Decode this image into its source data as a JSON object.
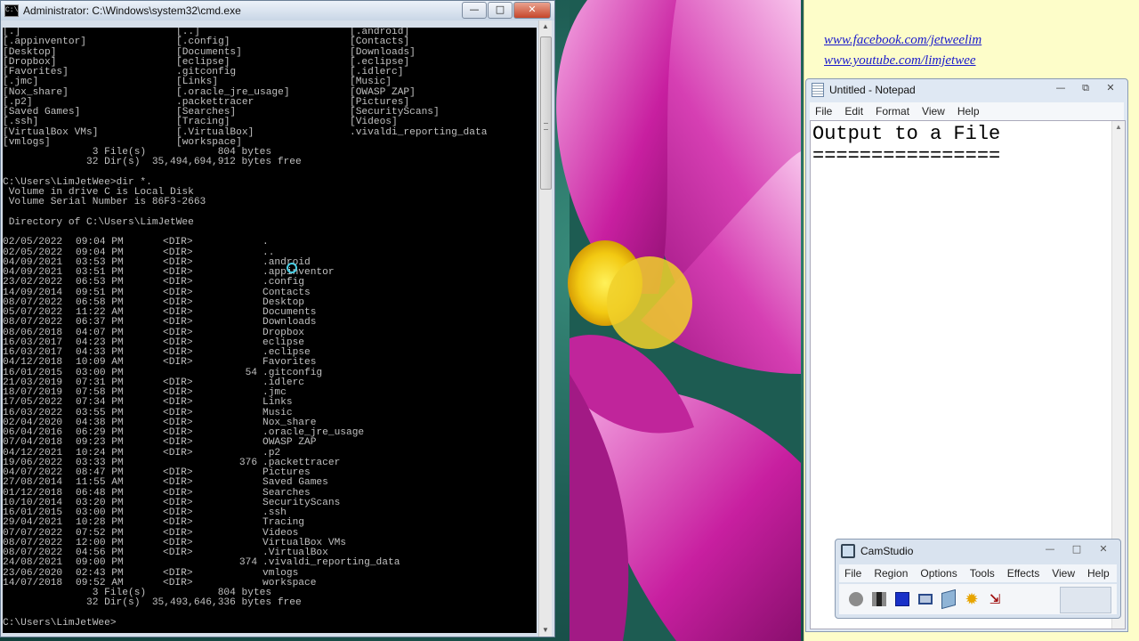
{
  "cmd": {
    "title": "Administrator: C:\\Windows\\system32\\cmd.exe",
    "icon": "cmd-icon",
    "buttons": {
      "minimize": "—",
      "maximize": "□",
      "close": "✕"
    },
    "wide_listing": [
      [
        "[.]",
        "[..]",
        "[.android]"
      ],
      [
        "[.appinventor]",
        "[.config]",
        "[Contacts]"
      ],
      [
        "[Desktop]",
        "[Documents]",
        "[Downloads]"
      ],
      [
        "[Dropbox]",
        "[eclipse]",
        "[.eclipse]"
      ],
      [
        "[Favorites]",
        ".gitconfig",
        "[.idlerc]"
      ],
      [
        "[.jmc]",
        "[Links]",
        "[Music]"
      ],
      [
        "[Nox_share]",
        "[.oracle_jre_usage]",
        "[OWASP ZAP]"
      ],
      [
        "[.p2]",
        ".packettracer",
        "[Pictures]"
      ],
      [
        "[Saved Games]",
        "[Searches]",
        "[SecurityScans]"
      ],
      [
        "[.ssh]",
        "[Tracing]",
        "[Videos]"
      ],
      [
        "[VirtualBox VMs]",
        "[.VirtualBox]",
        ".vivaldi_reporting_data"
      ],
      [
        "[vmlogs]",
        "[workspace]",
        ""
      ]
    ],
    "wide_summary": [
      "               3 File(s)            804 bytes",
      "              32 Dir(s)  35,494,694,912 bytes free"
    ],
    "command": "C:\\Users\\LimJetWee>dir *.",
    "volume_lines": [
      " Volume in drive C is Local Disk",
      " Volume Serial Number is 86F3-2663",
      "",
      " Directory of C:\\Users\\LimJetWee"
    ],
    "entries": [
      {
        "date": "02/05/2022",
        "time": "09:04 PM",
        "type": "<DIR>",
        "size": "",
        "name": "."
      },
      {
        "date": "02/05/2022",
        "time": "09:04 PM",
        "type": "<DIR>",
        "size": "",
        "name": ".."
      },
      {
        "date": "04/09/2021",
        "time": "03:53 PM",
        "type": "<DIR>",
        "size": "",
        "name": ".android"
      },
      {
        "date": "04/09/2021",
        "time": "03:51 PM",
        "type": "<DIR>",
        "size": "",
        "name": ".appinventor"
      },
      {
        "date": "23/02/2022",
        "time": "06:53 PM",
        "type": "<DIR>",
        "size": "",
        "name": ".config"
      },
      {
        "date": "14/09/2014",
        "time": "09:51 PM",
        "type": "<DIR>",
        "size": "",
        "name": "Contacts"
      },
      {
        "date": "08/07/2022",
        "time": "06:58 PM",
        "type": "<DIR>",
        "size": "",
        "name": "Desktop"
      },
      {
        "date": "05/07/2022",
        "time": "11:22 AM",
        "type": "<DIR>",
        "size": "",
        "name": "Documents"
      },
      {
        "date": "08/07/2022",
        "time": "06:37 PM",
        "type": "<DIR>",
        "size": "",
        "name": "Downloads"
      },
      {
        "date": "08/06/2018",
        "time": "04:07 PM",
        "type": "<DIR>",
        "size": "",
        "name": "Dropbox"
      },
      {
        "date": "16/03/2017",
        "time": "04:23 PM",
        "type": "<DIR>",
        "size": "",
        "name": "eclipse"
      },
      {
        "date": "16/03/2017",
        "time": "04:33 PM",
        "type": "<DIR>",
        "size": "",
        "name": ".eclipse"
      },
      {
        "date": "04/12/2018",
        "time": "10:09 AM",
        "type": "<DIR>",
        "size": "",
        "name": "Favorites"
      },
      {
        "date": "16/01/2015",
        "time": "03:00 PM",
        "type": "",
        "size": "54",
        "name": ".gitconfig"
      },
      {
        "date": "21/03/2019",
        "time": "07:31 PM",
        "type": "<DIR>",
        "size": "",
        "name": ".idlerc"
      },
      {
        "date": "18/07/2019",
        "time": "07:58 PM",
        "type": "<DIR>",
        "size": "",
        "name": ".jmc"
      },
      {
        "date": "17/05/2022",
        "time": "07:34 PM",
        "type": "<DIR>",
        "size": "",
        "name": "Links"
      },
      {
        "date": "16/03/2022",
        "time": "03:55 PM",
        "type": "<DIR>",
        "size": "",
        "name": "Music"
      },
      {
        "date": "02/04/2020",
        "time": "04:38 PM",
        "type": "<DIR>",
        "size": "",
        "name": "Nox_share"
      },
      {
        "date": "06/04/2016",
        "time": "06:29 PM",
        "type": "<DIR>",
        "size": "",
        "name": ".oracle_jre_usage"
      },
      {
        "date": "07/04/2018",
        "time": "09:23 PM",
        "type": "<DIR>",
        "size": "",
        "name": "OWASP ZAP"
      },
      {
        "date": "04/12/2021",
        "time": "10:24 PM",
        "type": "<DIR>",
        "size": "",
        "name": ".p2"
      },
      {
        "date": "19/06/2022",
        "time": "03:33 PM",
        "type": "",
        "size": "376",
        "name": ".packettracer"
      },
      {
        "date": "04/07/2022",
        "time": "08:47 PM",
        "type": "<DIR>",
        "size": "",
        "name": "Pictures"
      },
      {
        "date": "27/08/2014",
        "time": "11:55 AM",
        "type": "<DIR>",
        "size": "",
        "name": "Saved Games"
      },
      {
        "date": "01/12/2018",
        "time": "06:48 PM",
        "type": "<DIR>",
        "size": "",
        "name": "Searches"
      },
      {
        "date": "10/10/2014",
        "time": "03:20 PM",
        "type": "<DIR>",
        "size": "",
        "name": "SecurityScans"
      },
      {
        "date": "16/01/2015",
        "time": "03:00 PM",
        "type": "<DIR>",
        "size": "",
        "name": ".ssh"
      },
      {
        "date": "29/04/2021",
        "time": "10:28 PM",
        "type": "<DIR>",
        "size": "",
        "name": "Tracing"
      },
      {
        "date": "07/07/2022",
        "time": "07:52 PM",
        "type": "<DIR>",
        "size": "",
        "name": "Videos"
      },
      {
        "date": "08/07/2022",
        "time": "12:00 PM",
        "type": "<DIR>",
        "size": "",
        "name": "VirtualBox VMs"
      },
      {
        "date": "08/07/2022",
        "time": "04:56 PM",
        "type": "<DIR>",
        "size": "",
        "name": ".VirtualBox"
      },
      {
        "date": "24/08/2021",
        "time": "09:00 PM",
        "type": "",
        "size": "374",
        "name": ".vivaldi_reporting_data"
      },
      {
        "date": "23/06/2020",
        "time": "02:43 PM",
        "type": "<DIR>",
        "size": "",
        "name": "vmlogs"
      },
      {
        "date": "14/07/2018",
        "time": "09:52 AM",
        "type": "<DIR>",
        "size": "",
        "name": "workspace"
      }
    ],
    "summary": [
      "               3 File(s)            804 bytes",
      "              32 Dir(s)  35,493,646,336 bytes free"
    ],
    "prompt": "C:\\Users\\LimJetWee>"
  },
  "sticky": {
    "link1": "www.facebook.com/jetweelim",
    "link2": "www.youtube.com/limjetwee"
  },
  "notepad": {
    "title": "Untitled - Notepad",
    "menu": [
      "File",
      "Edit",
      "Format",
      "View",
      "Help"
    ],
    "content": "Output to a File\n================"
  },
  "camstudio": {
    "title": "CamStudio",
    "menu": [
      "File",
      "Region",
      "Options",
      "Tools",
      "Effects",
      "View",
      "Help"
    ],
    "tools": [
      "record-icon",
      "pause-icon",
      "stop-icon",
      "region-icon",
      "annotation-icon",
      "options-icon",
      "mini-mode-icon"
    ]
  },
  "colors": {
    "console_bg": "#000000",
    "console_fg": "#c0c0c0",
    "link": "#1a1acc",
    "sticky_bg": "#fdfdc9"
  }
}
